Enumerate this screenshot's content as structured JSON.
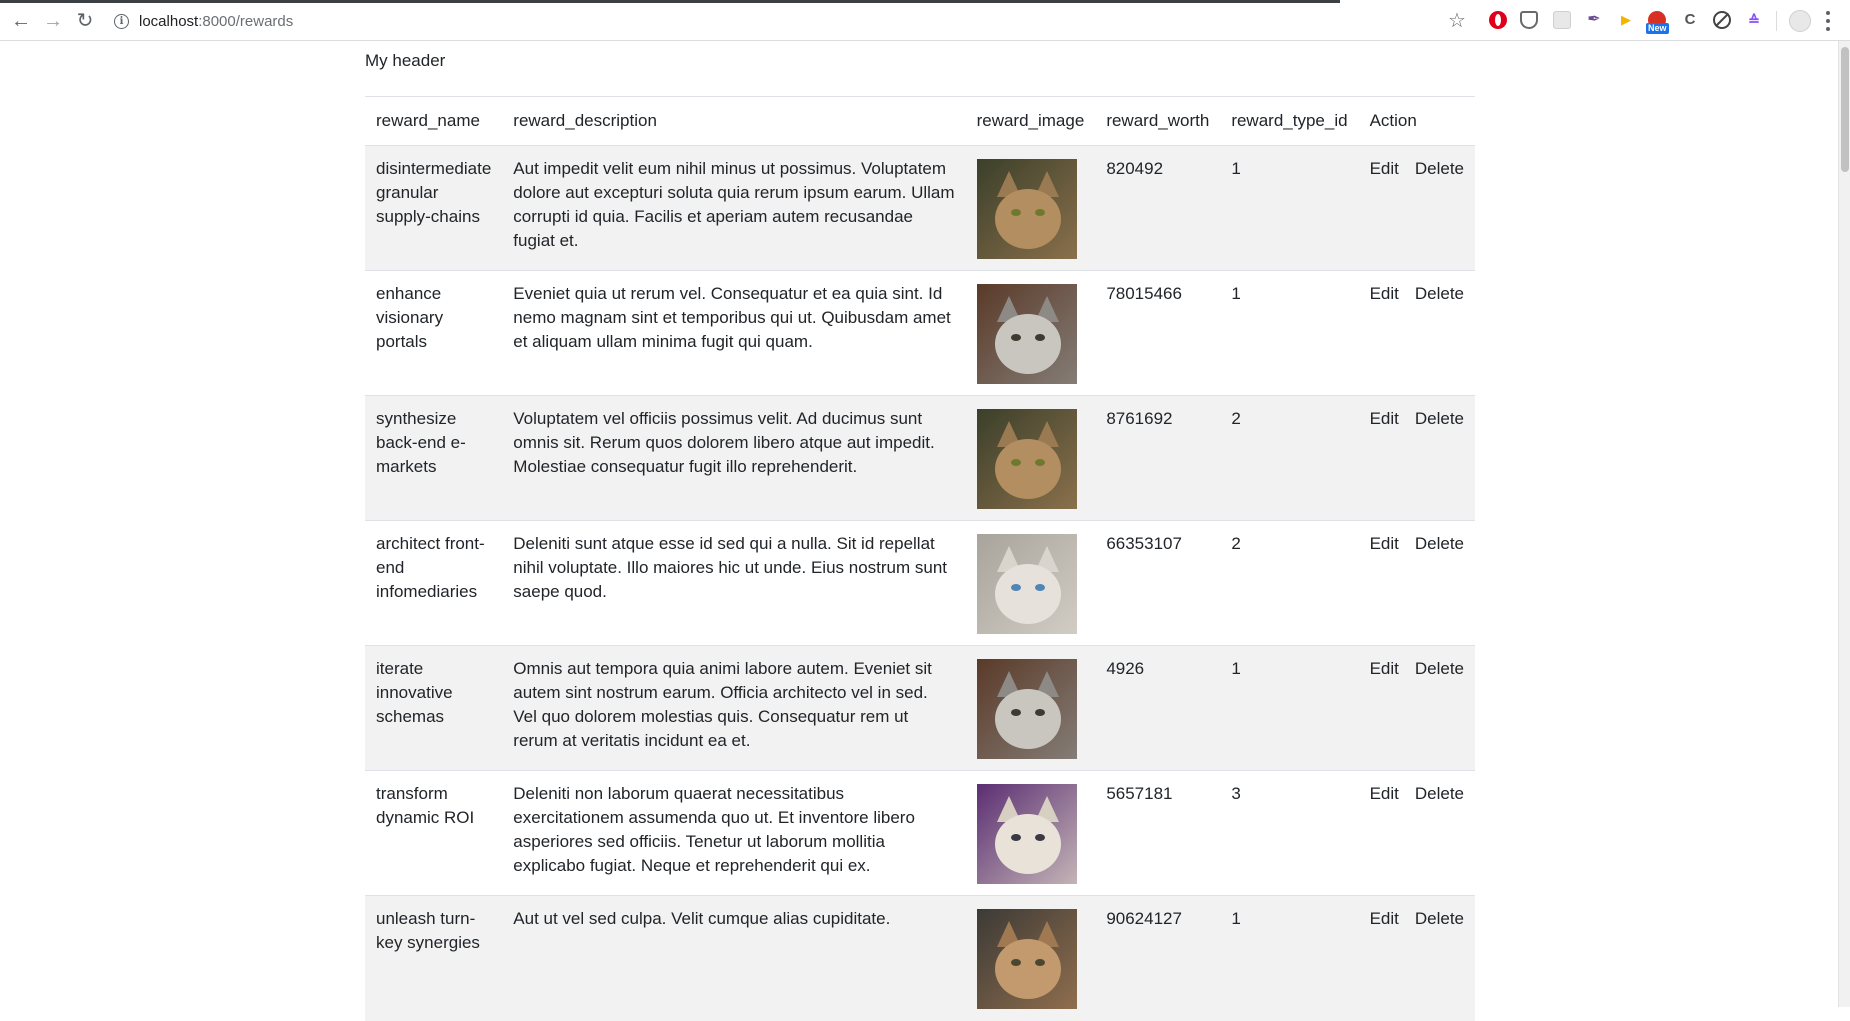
{
  "browser": {
    "url_host": "localhost",
    "url_path": ":8000/rewards",
    "extension_badge": "New"
  },
  "page": {
    "header": "My header"
  },
  "table": {
    "columns": [
      "reward_name",
      "reward_description",
      "reward_image",
      "reward_worth",
      "reward_type_id",
      "Action"
    ],
    "action_labels": {
      "edit": "Edit",
      "delete": "Delete"
    },
    "rows": [
      {
        "name": "disintermediate granular supply-chains",
        "description": "Aut impedit velit eum nihil minus ut possimus. Voluptatem dolore aut excepturi soluta quia rerum ipsum earum. Ullam corrupti id quia. Facilis et aperiam autem recusandae fugiat et.",
        "image": "tabby-cat-photo",
        "worth": "820492",
        "type_id": "1"
      },
      {
        "name": "enhance visionary portals",
        "description": "Eveniet quia ut rerum vel. Consequatur et ea quia sint. Id nemo magnam sint et temporibus qui ut. Quibusdam amet et aliquam ullam minima fugit qui quam.",
        "image": "grey-tabby-cat-photo",
        "worth": "78015466",
        "type_id": "1"
      },
      {
        "name": "synthesize back-end e-markets",
        "description": "Voluptatem vel officiis possimus velit. Ad ducimus sunt omnis sit. Rerum quos dolorem libero atque aut impedit. Molestiae consequatur fugit illo reprehenderit.",
        "image": "tabby-cat-photo",
        "worth": "8761692",
        "type_id": "2"
      },
      {
        "name": "architect front-end infomediaries",
        "description": "Deleniti sunt atque esse id sed qui a nulla. Sit id repellat nihil voluptate. Illo maiores hic ut unde. Eius nostrum sunt saepe quod.",
        "image": "siamese-cat-photo",
        "worth": "66353107",
        "type_id": "2"
      },
      {
        "name": "iterate innovative schemas",
        "description": "Omnis aut tempora quia animi labore autem. Eveniet sit autem sint nostrum earum. Officia architecto vel in sed. Vel quo dolorem molestias quis. Consequatur rem ut rerum at veritatis incidunt ea et.",
        "image": "grey-tabby-cat-photo",
        "worth": "4926",
        "type_id": "1"
      },
      {
        "name": "transform dynamic ROI",
        "description": "Deleniti non laborum quaerat necessitatibus exercitationem assumenda quo ut. Et inventore libero asperiores sed officiis. Tenetur ut laborum mollitia explicabo fugiat. Neque et reprehenderit qui ex.",
        "image": "fluffy-cat-photo",
        "worth": "5657181",
        "type_id": "3"
      },
      {
        "name": "unleash turn-key synergies",
        "description": "Aut ut vel sed culpa. Velit cumque alias cupiditate.",
        "image": "ginger-cat-photo",
        "worth": "90624127",
        "type_id": "1"
      }
    ]
  },
  "image_palettes": {
    "tabby-cat-photo": {
      "bg": "#3b3f2a",
      "fur": "#9a7a52",
      "face": "#b28e60",
      "eye": "#6d7a2e"
    },
    "grey-tabby-cat-photo": {
      "bg": "#5a3a28",
      "fur": "#8d8a86",
      "face": "#c9c6c0",
      "eye": "#3d3a30"
    },
    "siamese-cat-photo": {
      "bg": "#a8a49c",
      "fur": "#d9d4cc",
      "face": "#e6e1da",
      "eye": "#4f86b8"
    },
    "fluffy-cat-photo": {
      "bg": "#5b2e73",
      "fur": "#d8cfc3",
      "face": "#e9e2d8",
      "eye": "#3b3a44"
    },
    "ginger-cat-photo": {
      "bg": "#3c3a36",
      "fur": "#a07852",
      "face": "#c29a6e",
      "eye": "#4a4630"
    }
  }
}
